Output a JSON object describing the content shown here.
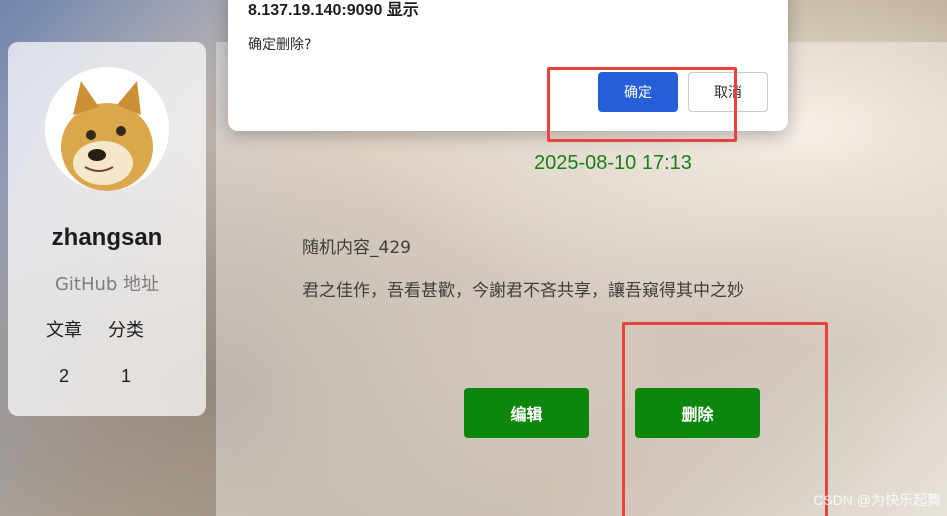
{
  "dialog": {
    "origin": "8.137.19.140:9090 显示",
    "message": "确定删除?",
    "ok_label": "确定",
    "cancel_label": "取消",
    "ok_color": "#1a56d6"
  },
  "profile": {
    "username": "zhangsan",
    "github_label": "GitHub 地址",
    "stats": [
      {
        "label": "文章",
        "value": "2"
      },
      {
        "label": "分类",
        "value": "1"
      }
    ]
  },
  "post": {
    "date": "2025-08-10 17:13",
    "title": "随机内容_429",
    "body": "君之佳作，吾看甚歡，今謝君不吝共享，讓吾窺得其中之妙",
    "edit_label": "编辑",
    "delete_label": "删除",
    "accent_color": "#008000"
  },
  "watermark": "CSDN @为快乐起舞"
}
